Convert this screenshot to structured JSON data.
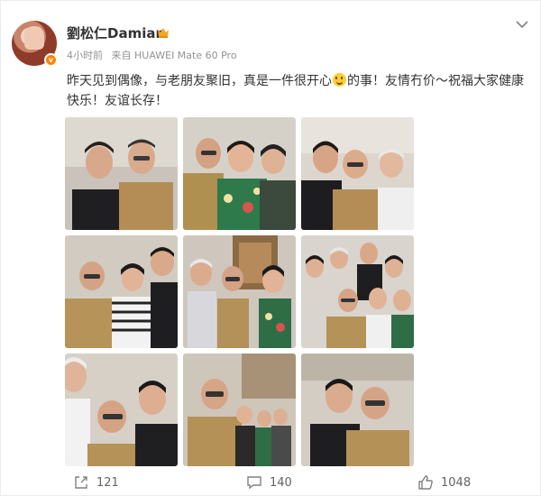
{
  "post": {
    "author": "劉松仁Damian",
    "time": "4小时前",
    "source": "来自 HUAWEI Mate 60 Pro",
    "text_before_emoji": "昨天见到偶像，与老朋友聚旧，真是一件很开心",
    "text_after_emoji": "的事！友情冇价～祝福大家健康快乐！友谊长存！",
    "photo_count": 9
  },
  "actions": {
    "share_count": "121",
    "comment_count": "140",
    "like_count": "1048"
  },
  "colors": {
    "accent": "#ff8200",
    "meta_text": "#939393",
    "body_text": "#333333"
  },
  "icons": [
    "crown-icon",
    "verified-badge-icon",
    "chevron-down-icon",
    "share-icon",
    "comment-icon",
    "like-icon",
    "smile-emoji-icon"
  ]
}
